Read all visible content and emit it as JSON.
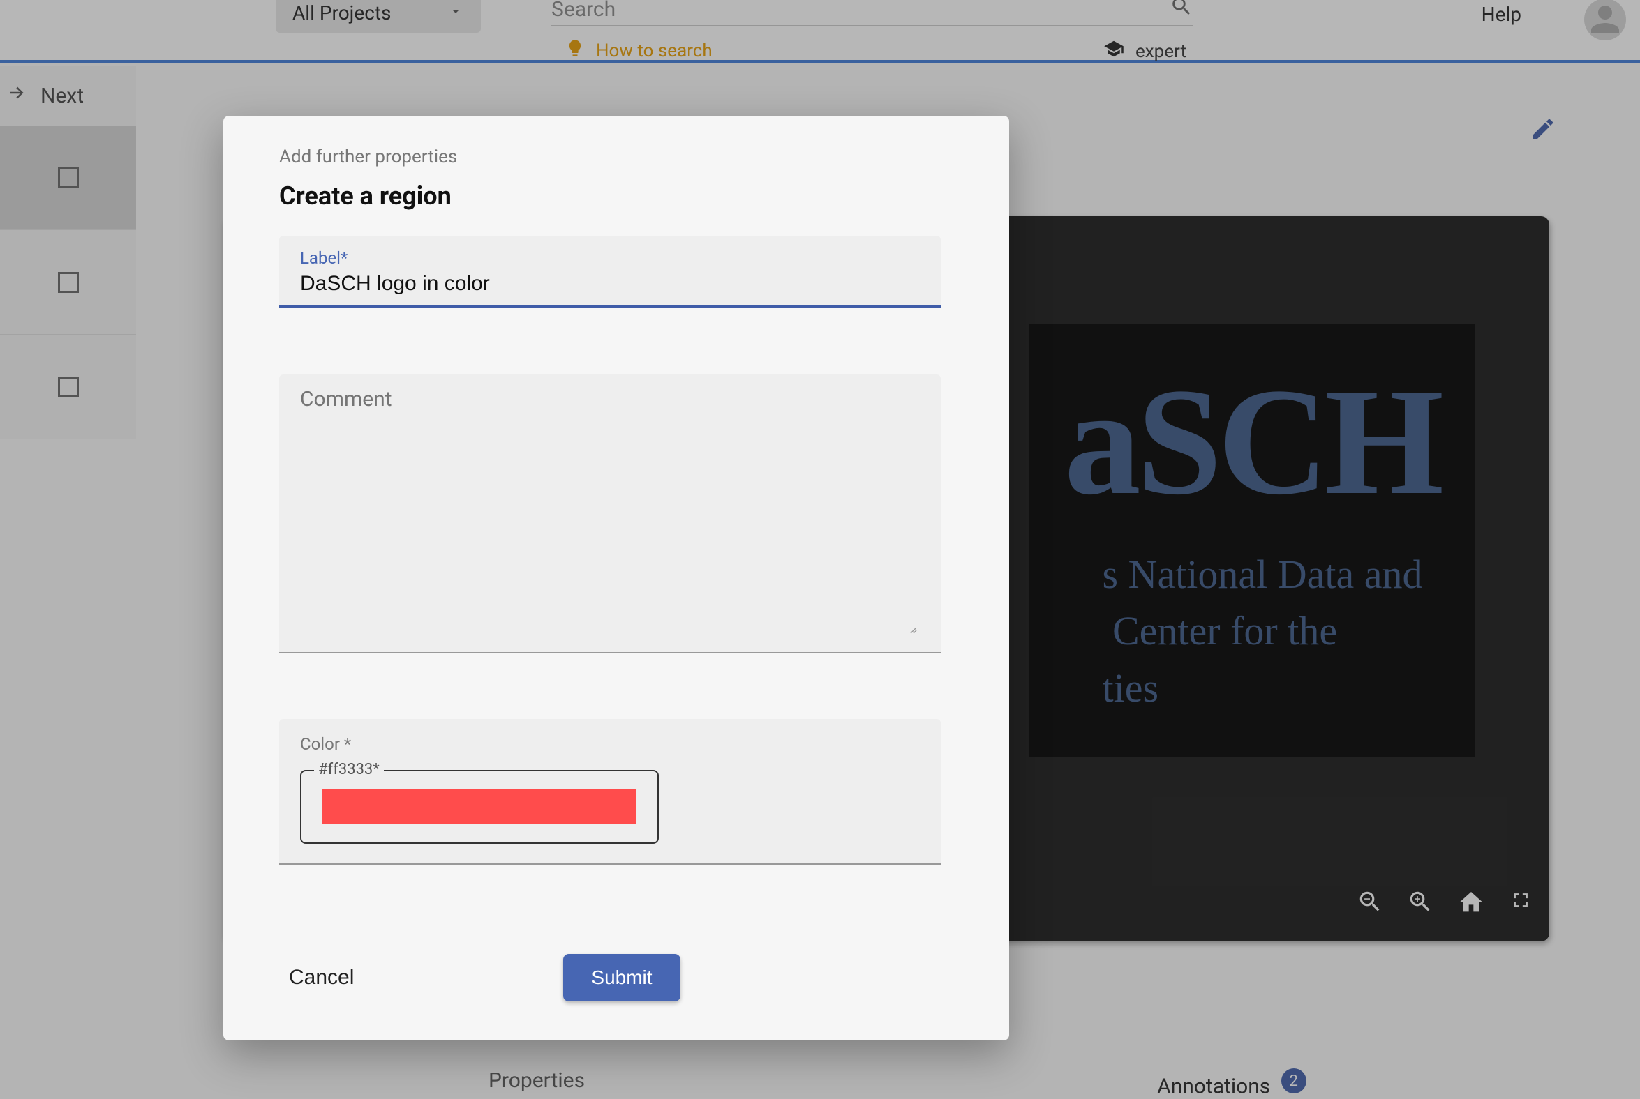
{
  "header": {
    "projects_label": "All Projects",
    "search_placeholder": "Search",
    "how_to_search": "How to search",
    "expert_label": "expert",
    "help_label": "Help"
  },
  "sidebar": {
    "next_label": "Next"
  },
  "viewer": {
    "title_line1": "aSCH",
    "subtitle": "s National Data and Center for the ties"
  },
  "tabs": {
    "properties_label": "Properties",
    "annotations_label": "Annotations",
    "annotations_count": "2"
  },
  "dialog": {
    "sub_label": "Add further properties",
    "title": "Create a region",
    "label_field_tag": "Label*",
    "label_value": "DaSCH logo in color",
    "comment_placeholder": "Comment",
    "color_field_label": "Color *",
    "color_hex_label": "#ff3333*",
    "color_value": "#ff4c4c",
    "cancel_label": "Cancel",
    "submit_label": "Submit"
  }
}
